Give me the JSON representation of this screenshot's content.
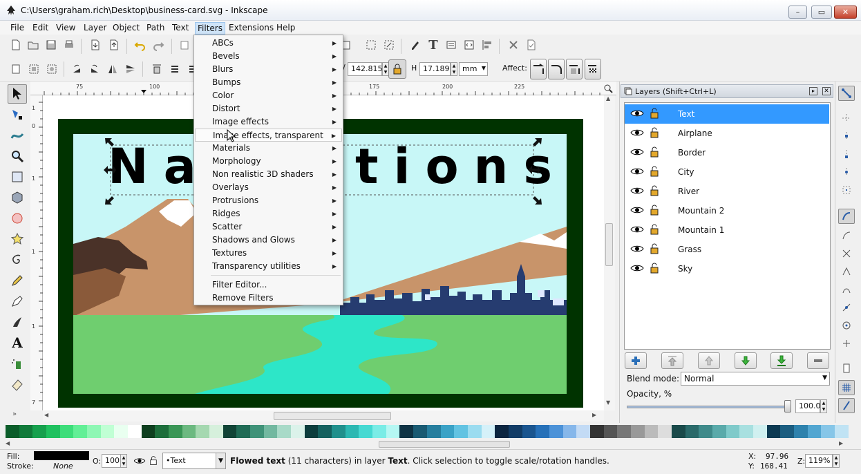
{
  "window": {
    "title": "C:\\Users\\graham.rich\\Desktop\\business-card.svg - Inkscape"
  },
  "menubar": [
    "File",
    "Edit",
    "View",
    "Layer",
    "Object",
    "Path",
    "Text",
    "Filters",
    "Extensions",
    "Help"
  ],
  "filters_menu": {
    "items": [
      "ABCs",
      "Bevels",
      "Blurs",
      "Bumps",
      "Color",
      "Distort",
      "Image effects",
      "Image effects, transparent",
      "Materials",
      "Morphology",
      "Non realistic 3D shaders",
      "Overlays",
      "Protrusions",
      "Ridges",
      "Scatter",
      "Shadows and Glows",
      "Textures",
      "Transparency utilities"
    ],
    "actions": [
      "Filter Editor...",
      "Remove Filters"
    ],
    "hovered": "Image effects, transparent"
  },
  "controls": {
    "w_value": "142.815",
    "h_label": "H",
    "h_value": "17.189",
    "unit": "mm",
    "affect_label": "Affect:"
  },
  "rulers": {
    "h_ticks": [
      "75",
      "100",
      "175",
      "200",
      "225"
    ],
    "v_ticks": [
      "1",
      "0",
      "1",
      "1",
      "1",
      "7"
    ]
  },
  "canvas": {
    "visible_text_left": "Na",
    "visible_text_right": "tions"
  },
  "layers": {
    "title": "Layers (Shift+Ctrl+L)",
    "items": [
      "Text",
      "Airplane",
      "Border",
      "City",
      "River",
      "Mountain 2",
      "Mountain 1",
      "Grass",
      "Sky"
    ],
    "selected": "Text",
    "blend_label": "Blend mode:",
    "blend_value": "Normal",
    "opacity_label": "Opacity, %",
    "opacity_value": "100.0",
    "opacity_fraction": 1.0
  },
  "status": {
    "fill_label": "Fill:",
    "stroke_label": "Stroke:",
    "stroke_value": "None",
    "o_label": "O:",
    "o_value": "100",
    "layer_value": "•Text",
    "message_bold1": "Flowed text",
    "message_part1": " (11 characters) in layer ",
    "message_bold2": "Text",
    "message_part2": ". Click selection to toggle scale/rotation handles.",
    "x_label": "X:",
    "x_value": "97.96",
    "y_label": "Y:",
    "y_value": "168.41",
    "z_label": "Z:",
    "zoom_value": "119%"
  },
  "colors": {
    "selected_row": "#3399ff",
    "border": "#003300",
    "sky": "#c8f7f7",
    "grass": "#6fce6f",
    "river": "#2de6c8",
    "mountain": "#c8946a",
    "city": "#263c70"
  },
  "palette": [
    "#0b5d2a",
    "#117a3a",
    "#16a04d",
    "#1fc15f",
    "#3ddd7a",
    "#62ef96",
    "#8ef7b4",
    "#c0ffd4",
    "#e9fff0",
    "#ffffff",
    "#0f3f1f",
    "#1d6e3b",
    "#3a9656",
    "#6cb980",
    "#a5d8b0",
    "#d6f0dc",
    "#114436",
    "#206b55",
    "#3f9278",
    "#72b8a0",
    "#a8dac8",
    "#dbf2ea",
    "#0c3d3d",
    "#15615f",
    "#20908c",
    "#2cb8b2",
    "#46d9d2",
    "#7aece6",
    "#b5f7f3",
    "#0f3344",
    "#195a72",
    "#267e9e",
    "#3aa2c6",
    "#62c3e2",
    "#9bdcf0",
    "#d5f1f9",
    "#0c2540",
    "#123c66",
    "#1a558f",
    "#2670b8",
    "#4c92d8",
    "#86b7ea",
    "#c3dbf5",
    "#333333",
    "#555555",
    "#777777",
    "#999999",
    "#bbbbbb",
    "#dddddd",
    "#1a4a4a",
    "#2a6a6a",
    "#3f8a8a",
    "#5aaaaa",
    "#7fcaca",
    "#a8e0e0",
    "#d0f0f0",
    "#0d3a52",
    "#1b5d80",
    "#2e82ad",
    "#52a6d1",
    "#86c6e8",
    "#c0e3f4"
  ],
  "icons": {
    "app": "inkscape-icon",
    "eye": "eye-icon",
    "lock": "lock-open-icon"
  }
}
